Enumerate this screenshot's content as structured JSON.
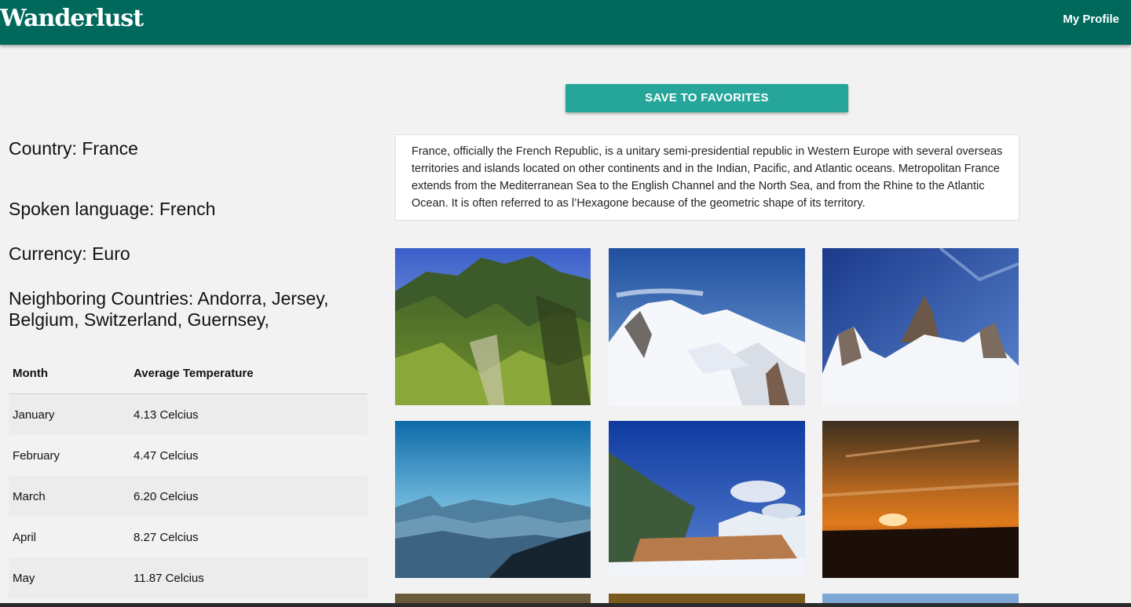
{
  "header": {
    "brand": "Wanderlust",
    "profile_link": "My Profile"
  },
  "actions": {
    "save_label": "SAVE TO FAVORITES"
  },
  "country": {
    "name_line": "Country: France",
    "language_line": "Spoken language: French",
    "currency_line": "Currency: Euro",
    "neighbors_line": "Neighboring Countries: Andorra, Jersey, Belgium, Switzerland, Guernsey,"
  },
  "description": "France, officially the French Republic, is a unitary semi-presidential republic in Western Europe with several overseas territories and islands located on other continents and in the Indian, Pacific, and Atlantic oceans. Metropolitan France extends from the Mediterranean Sea to the English Channel and the North Sea, and from the Rhine to the Atlantic Ocean. It is often referred to as l’Hexagone because of the geometric shape of its territory.",
  "temperature_table": {
    "headers": [
      "Month",
      "Average Temperature"
    ],
    "rows": [
      {
        "month": "January",
        "temp": "4.13 Celcius"
      },
      {
        "month": "February",
        "temp": "4.47 Celcius"
      },
      {
        "month": "March",
        "temp": "6.20 Celcius"
      },
      {
        "month": "April",
        "temp": "8.27 Celcius"
      },
      {
        "month": "May",
        "temp": "11.87 Celcius"
      }
    ]
  },
  "colors": {
    "navbar": "#00695c",
    "button": "#26a69a",
    "background": "#f2f2f2"
  }
}
